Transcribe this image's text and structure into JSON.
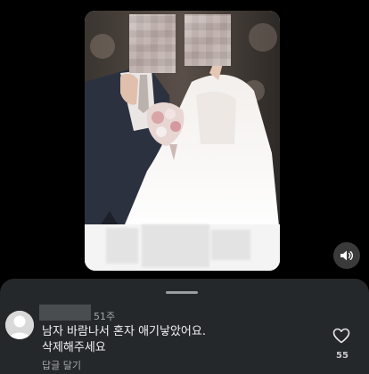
{
  "comment": {
    "timestamp": "51주",
    "lines": [
      "남자 바람나서 혼자 애기낳았어요.",
      "삭제해주세요"
    ],
    "reply_label": "답글 달기",
    "like_count": "55"
  },
  "icons": {
    "volume": "volume-icon",
    "like": "heart-icon",
    "avatar": "default-avatar-icon"
  },
  "colors": {
    "sheet_background": "#25282b",
    "secondary_text": "#a6a9ac"
  }
}
